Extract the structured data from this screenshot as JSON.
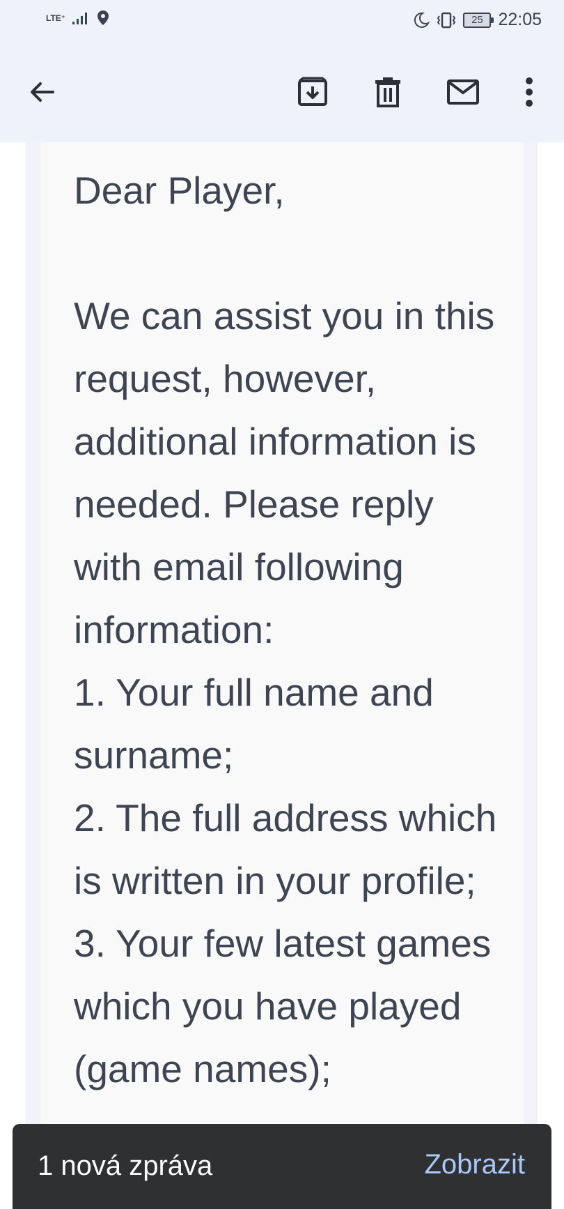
{
  "status_bar": {
    "network": "LTE⁺",
    "battery": "25",
    "time": "22:05"
  },
  "toolbar": {
    "back": "back-arrow-icon",
    "archive": "archive-icon",
    "delete": "trash-icon",
    "mark_unread": "mail-icon",
    "more": "more-vert-icon"
  },
  "email": {
    "greeting": "Dear Player,",
    "body_intro": "We can assist you in this request, however, additional information is needed. Please reply with email following information:",
    "items": [
      "1. Your full name and surname;",
      "2. The full address which is written in your profile;",
      "3. Your few latest games which you have played (game names);"
    ]
  },
  "snackbar": {
    "message": "1 nová zpráva",
    "action": "Zobrazit"
  },
  "colors": {
    "header_bg": "#eef2fa",
    "card_bg": "#f9f9fa",
    "text": "#3d4452",
    "snackbar_bg": "#2f3031",
    "snackbar_action": "#a8c7fa"
  }
}
